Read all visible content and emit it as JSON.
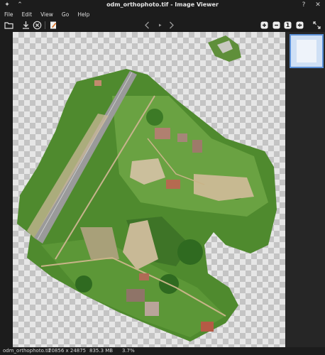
{
  "window": {
    "title": "odm_orthophoto.tif - Image Viewer"
  },
  "menu": [
    "File",
    "Edit",
    "View",
    "Go",
    "Help"
  ],
  "toolbar": {
    "zoom_reset_label": "1"
  },
  "status": {
    "filename": "odm_orthophoto.tif",
    "dimensions": "20856 x 24875",
    "filesize": "835.3 MB",
    "zoom": "3.7%"
  },
  "colors": {
    "accent": "#5a8fd6",
    "vegetation": "#4f8a2e",
    "road": "#8e8e8e"
  },
  "icons": [
    "pin-icon",
    "chevron-up-icon",
    "help-icon",
    "close-icon",
    "open-folder-icon",
    "save-icon",
    "delete-icon",
    "edit-icon",
    "previous-icon",
    "play-icon",
    "next-icon",
    "zoom-in-icon",
    "zoom-out-icon",
    "zoom-fit-icon",
    "fullscreen-icon"
  ]
}
